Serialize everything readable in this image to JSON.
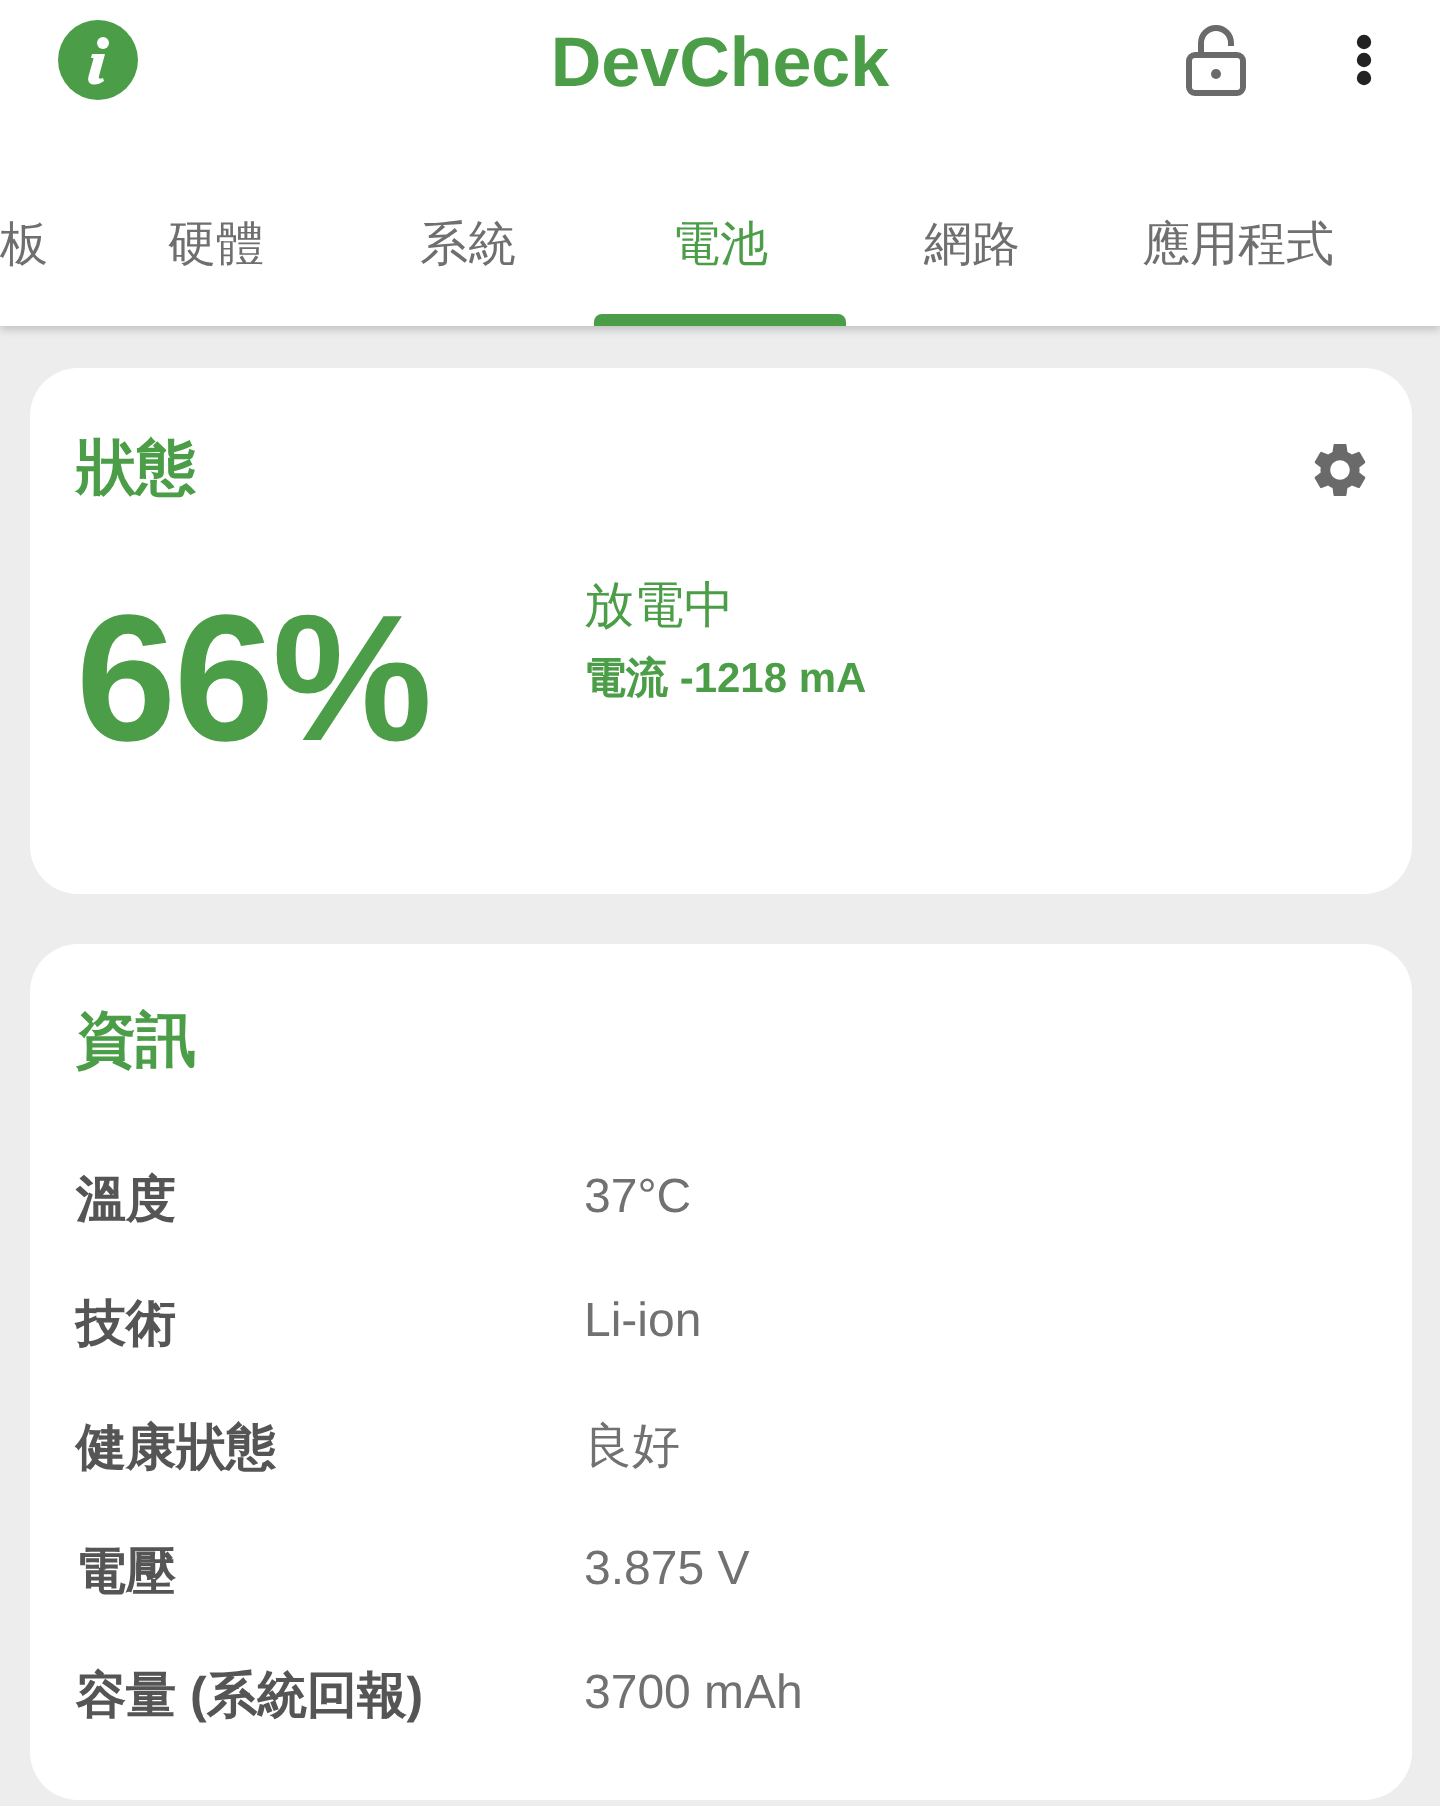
{
  "app_bar": {
    "title": "DevCheck"
  },
  "tabs": [
    {
      "label": "板",
      "selected": false
    },
    {
      "label": "硬體",
      "selected": false
    },
    {
      "label": "系統",
      "selected": false
    },
    {
      "label": "電池",
      "selected": true
    },
    {
      "label": "網路",
      "selected": false
    },
    {
      "label": "應用程式",
      "selected": false
    }
  ],
  "status_card": {
    "title": "狀態",
    "percent": "66%",
    "state": "放電中",
    "current": "電流 -1218 mA"
  },
  "info_card": {
    "title": "資訊",
    "rows": [
      {
        "label": "溫度",
        "value": "37°C"
      },
      {
        "label": "技術",
        "value": "Li-ion"
      },
      {
        "label": "健康狀態",
        "value": "良好"
      },
      {
        "label": "電壓",
        "value": "3.875 V"
      },
      {
        "label": "容量 (系統回報)",
        "value": "3700 mAh"
      }
    ]
  }
}
